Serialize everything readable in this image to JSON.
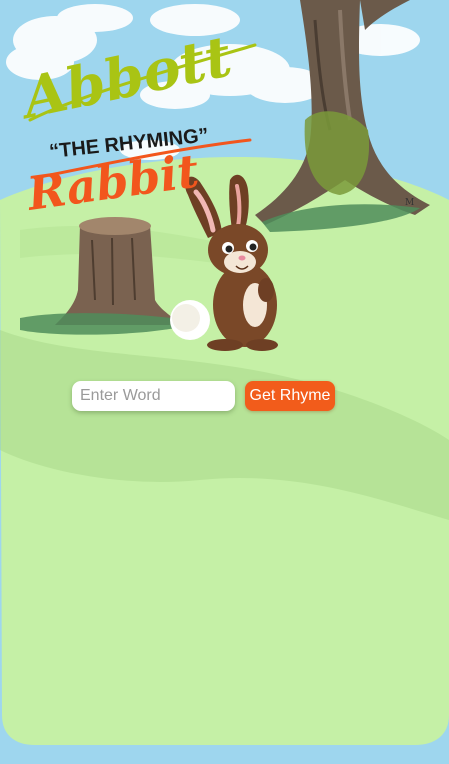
{
  "title": {
    "line1": "Abbott",
    "line2": "“THE RHYMING”",
    "line3": "Rabbit"
  },
  "artist_signature": "M",
  "search": {
    "placeholder": "Enter Word",
    "value": ""
  },
  "actions": {
    "get_rhyme_label": "Get Rhyme"
  },
  "colors": {
    "sky": "#9ed6ee",
    "grass": "#c5f0a6",
    "title_green": "#a9c414",
    "title_orange": "#f2561d",
    "button": "#f25c1b"
  }
}
